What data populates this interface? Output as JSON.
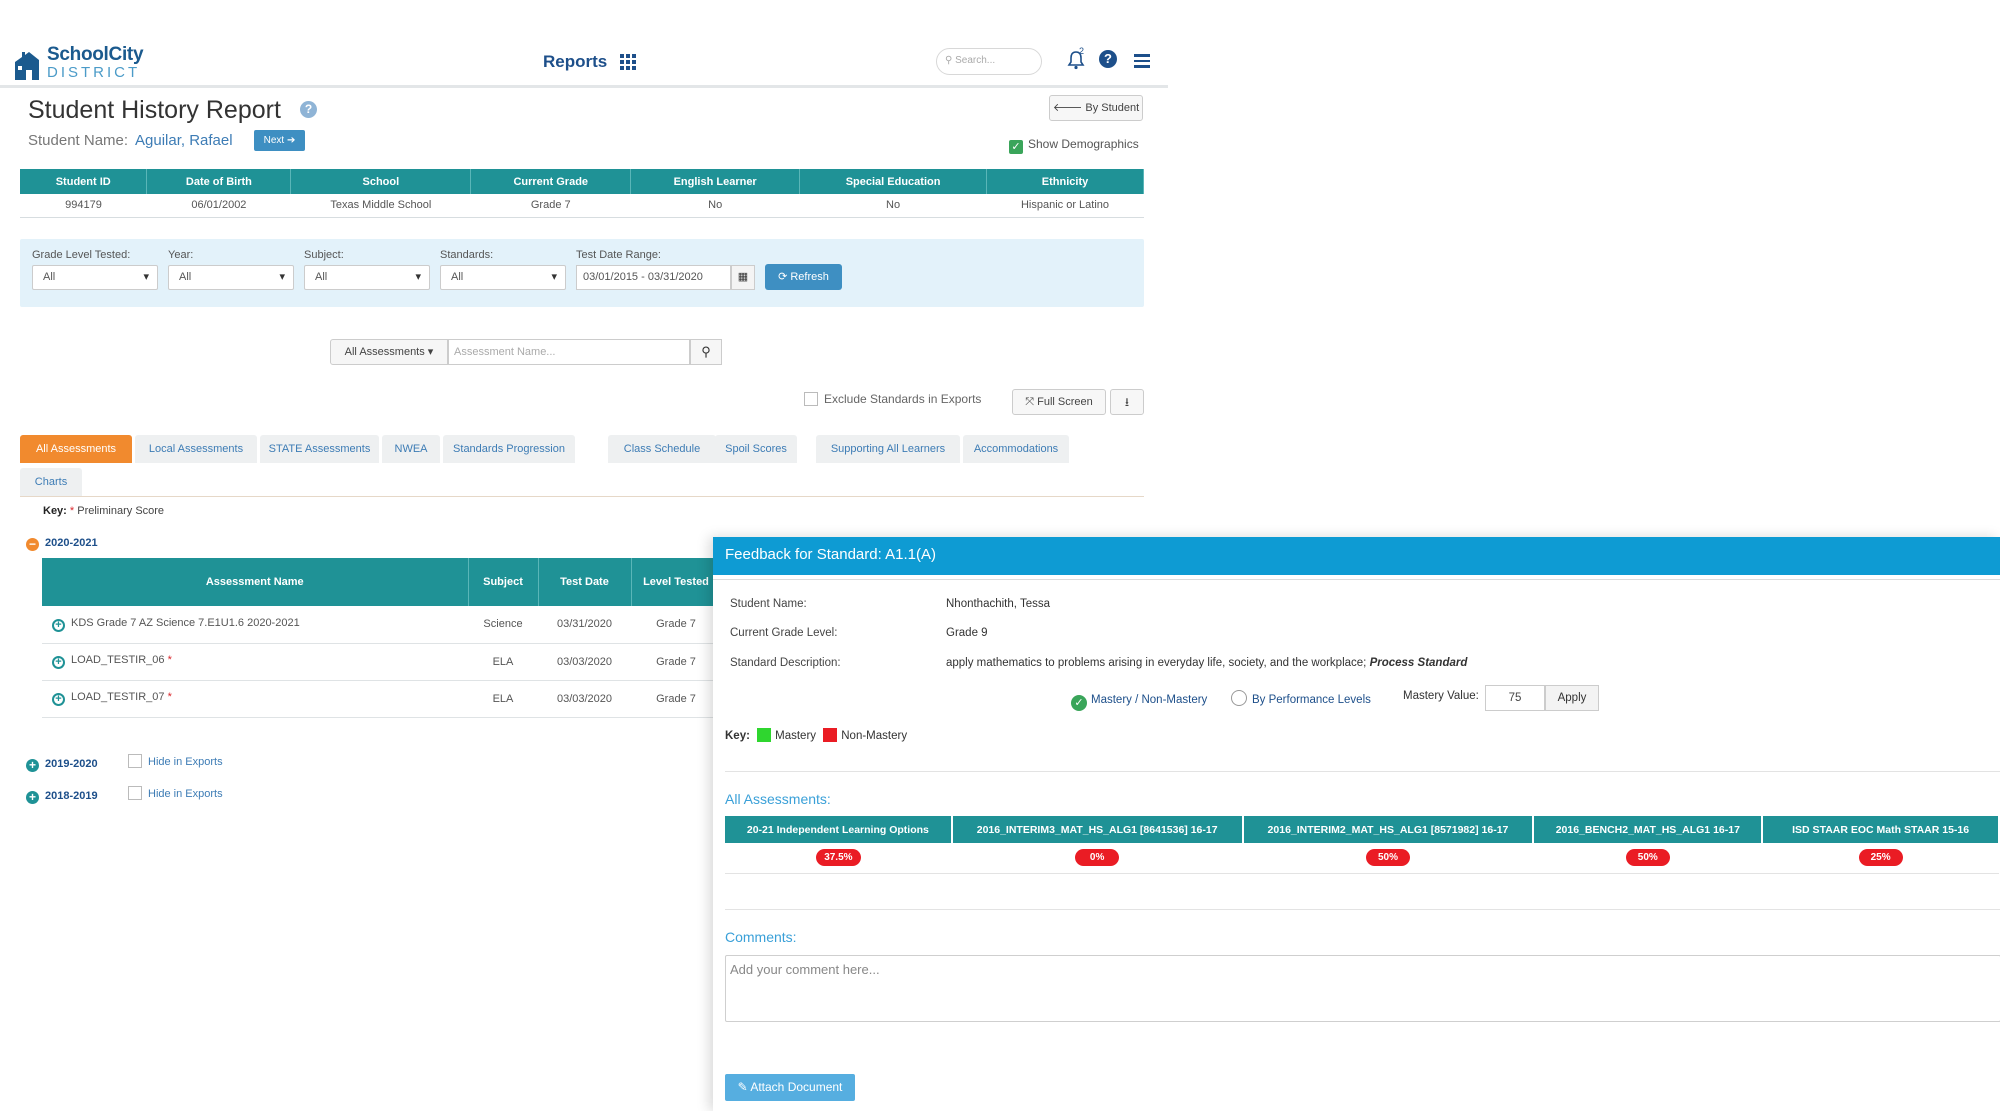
{
  "header": {
    "logo_name": "SchoolCity",
    "logo_sub": "DISTRICT",
    "nav_reports": "Reports",
    "search_placeholder": "Search...",
    "notification_count": "2"
  },
  "report": {
    "title": "Student History Report",
    "student_label": "Student Name:",
    "student_name": "Aguilar, Rafael",
    "next_label": "Next ➔",
    "by_student_label": "🡐 By Student",
    "show_demographics_label": "Show Demographics"
  },
  "demographics": {
    "columns": [
      "Student ID",
      "Date of Birth",
      "School",
      "Current Grade",
      "English Learner",
      "Special Education",
      "Ethnicity"
    ],
    "row": [
      "994179",
      "06/01/2002",
      "Texas Middle School",
      "Grade 7",
      "No",
      "No",
      "Hispanic or Latino"
    ]
  },
  "filters": {
    "grade_label": "Grade Level Tested:",
    "grade_value": "All",
    "year_label": "Year:",
    "year_value": "All",
    "subject_label": "Subject:",
    "subject_value": "All",
    "standards_label": "Standards:",
    "standards_value": "All",
    "date_label": "Test Date Range:",
    "date_value": "03/01/2015 - 03/31/2020",
    "refresh_label": "⟳ Refresh"
  },
  "assessment_search": {
    "dropdown_label": "All Assessments ▾",
    "placeholder": "Assessment Name..."
  },
  "toolbar": {
    "exclude_label": "Exclude Standards in Exports",
    "full_screen_label": "⤧ Full Screen"
  },
  "tabs": [
    "All Assessments",
    "Local Assessments",
    "STATE Assessments",
    "NWEA",
    "Standards Progression",
    "Class Schedule",
    "Spoil Scores",
    "Supporting All Learners",
    "Accommodations",
    "Charts"
  ],
  "key": {
    "label": "Key:",
    "text": "Preliminary Score"
  },
  "years": {
    "open": "2020-2021",
    "closed": [
      {
        "year": "2019-2020",
        "hide_label": "Hide in Exports"
      },
      {
        "year": "2018-2019",
        "hide_label": "Hide in Exports"
      }
    ]
  },
  "assessments_table": {
    "columns": [
      "Assessment Name",
      "Subject",
      "Test Date",
      "Level Tested"
    ],
    "rows": [
      {
        "name": "KDS Grade 7 AZ Science 7.E1U1.6 2020-2021",
        "preliminary": false,
        "subject": "Science",
        "date": "03/31/2020",
        "level": "Grade 7"
      },
      {
        "name": "LOAD_TESTIR_06",
        "preliminary": true,
        "subject": "ELA",
        "date": "03/03/2020",
        "level": "Grade 7"
      },
      {
        "name": "LOAD_TESTIR_07",
        "preliminary": true,
        "subject": "ELA",
        "date": "03/03/2020",
        "level": "Grade 7"
      }
    ]
  },
  "feedback": {
    "title": "Feedback for Standard: A1.1(A)",
    "student_name_label": "Student Name:",
    "student_name": "Nhonthachith, Tessa",
    "grade_label": "Current Grade Level:",
    "grade": "Grade 9",
    "desc_label": "Standard Description:",
    "desc": "apply mathematics to problems arising in everyday life, society, and the workplace;",
    "desc_emphasis": "Process Standard",
    "radio_mastery": "Mastery / Non-Mastery",
    "radio_perf": "By Performance Levels",
    "mastery_value_label": "Mastery Value:",
    "mastery_value": "75",
    "apply_label": "Apply",
    "key_label": "Key:",
    "key_mastery": "Mastery",
    "key_non_mastery": "Non-Mastery",
    "all_assessments_title": "All Assessments:",
    "assessments": [
      {
        "name": "20-21 Independent Learning Options",
        "score": "37.5%"
      },
      {
        "name": "2016_INTERIM3_MAT_HS_ALG1 [8641536] 16-17",
        "score": "0%"
      },
      {
        "name": "2016_INTERIM2_MAT_HS_ALG1 [8571982] 16-17",
        "score": "50%"
      },
      {
        "name": "2016_BENCH2_MAT_HS_ALG1 16-17",
        "score": "50%"
      },
      {
        "name": "ISD STAAR EOC Math STAAR 15-16",
        "score": "25%"
      }
    ],
    "comments_title": "Comments:",
    "comment_placeholder": "Add your comment here...",
    "attach_label": "✎ Attach Document"
  },
  "colors": {
    "teal": "#1f9296",
    "orange_tab": "#f18a2e",
    "modal_header": "#0e9bd3",
    "mastery_green": "#2fd62f",
    "non_mastery_red": "#ea1c24"
  }
}
